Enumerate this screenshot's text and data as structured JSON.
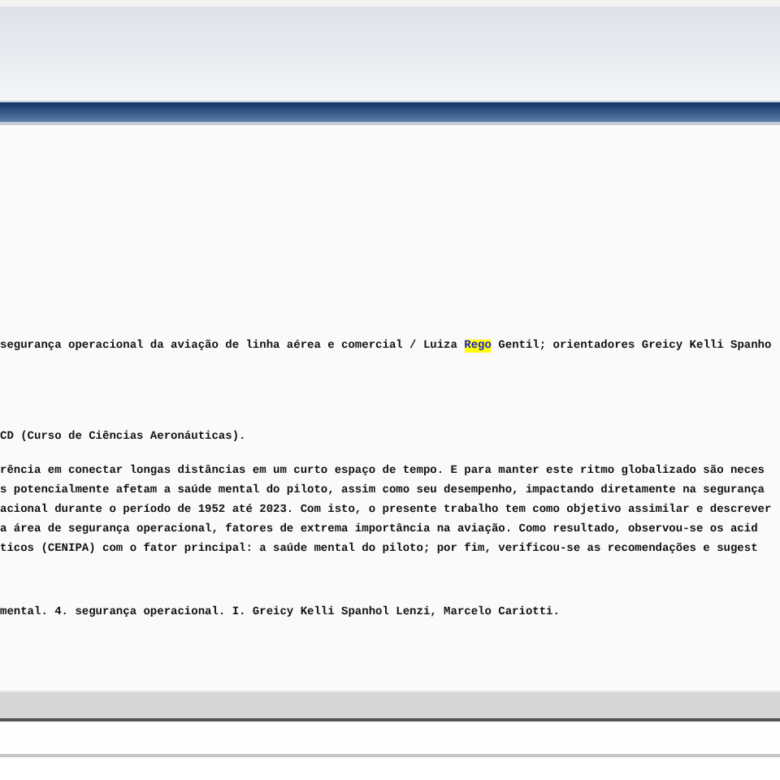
{
  "record": {
    "title_line": [
      {
        "text": "segurança operacional da aviação de linha aérea e comercial / Luiza ",
        "highlighted": false
      },
      {
        "text": "Rego",
        "highlighted": true
      },
      {
        "text": " Gentil; orientadores Greicy Kelli Spanho",
        "highlighted": false
      }
    ],
    "note": "CD (Curso de Ciências Aeronáuticas).",
    "abstract_lines": [
      "rência em conectar longas distâncias em um curto espaço de tempo. E para manter este ritmo globalizado são neces",
      "s potencialmente afetam a saúde mental do piloto, assim como seu desempenho, impactando diretamente na segurança",
      "acional durante o período de 1952 até 2023. Com isto, o presente trabalho tem como objetivo assimilar e descrever",
      "a área de segurança operacional, fatores de extrema importância na aviação. Como resultado, observou-se os acid",
      "ticos (CENIPA) com o fator principal: a saúde mental do piloto; por fim, verificou-se as recomendações e sugest"
    ],
    "subjects": "mental. 4. segurança operacional. I. Greicy Kelli Spanhol Lenzi, Marcelo Cariotti."
  }
}
